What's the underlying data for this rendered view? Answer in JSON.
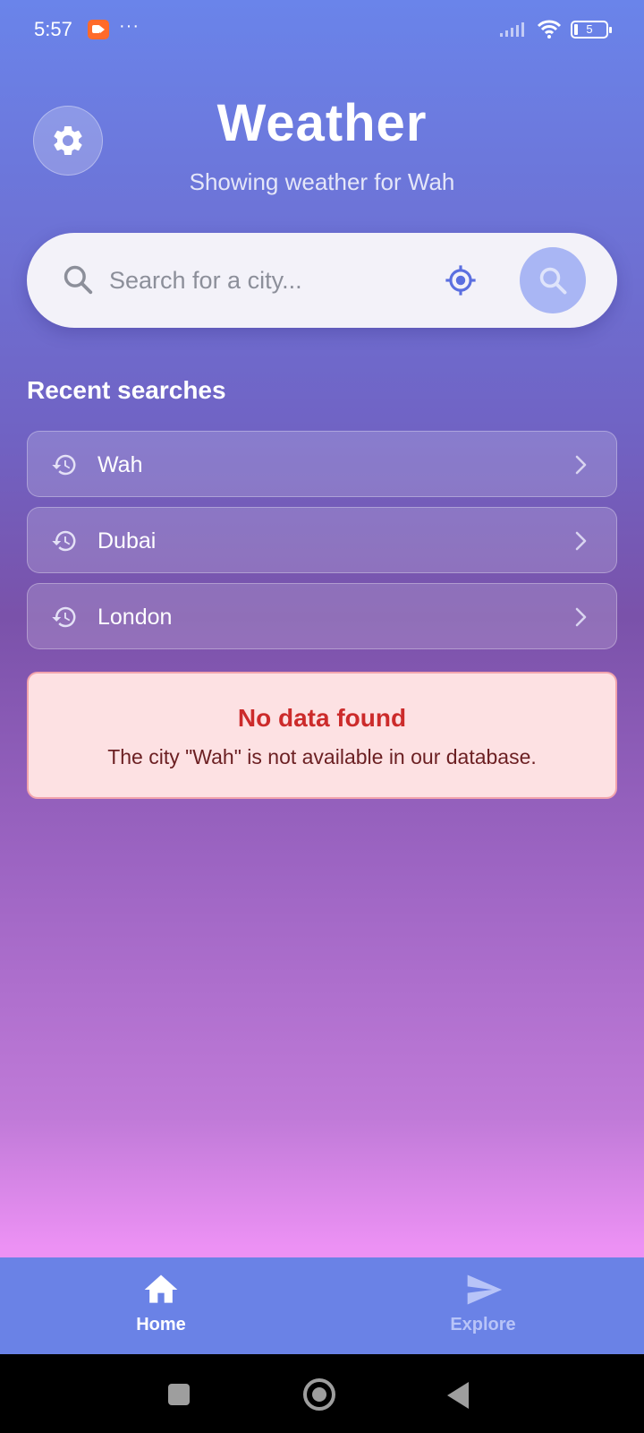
{
  "status_bar": {
    "time": "5:57",
    "more": "···",
    "battery": "5"
  },
  "header": {
    "title": "Weather",
    "subtitle": "Showing weather for Wah"
  },
  "search": {
    "placeholder": "Search for a city...",
    "value": ""
  },
  "recent": {
    "title": "Recent searches",
    "items": [
      {
        "label": "Wah"
      },
      {
        "label": "Dubai"
      },
      {
        "label": "London"
      }
    ]
  },
  "error": {
    "title": "No data found",
    "message": "The city \"Wah\" is not available in our database."
  },
  "nav": {
    "items": [
      {
        "label": "Home",
        "icon": "home-icon",
        "active": true
      },
      {
        "label": "Explore",
        "icon": "send-icon",
        "active": false
      }
    ]
  },
  "colors": {
    "error_title": "#cc2b2b",
    "error_bg": "#fde1e3",
    "nav_bg": "#6a82e6",
    "accent": "#5b6fe0"
  }
}
